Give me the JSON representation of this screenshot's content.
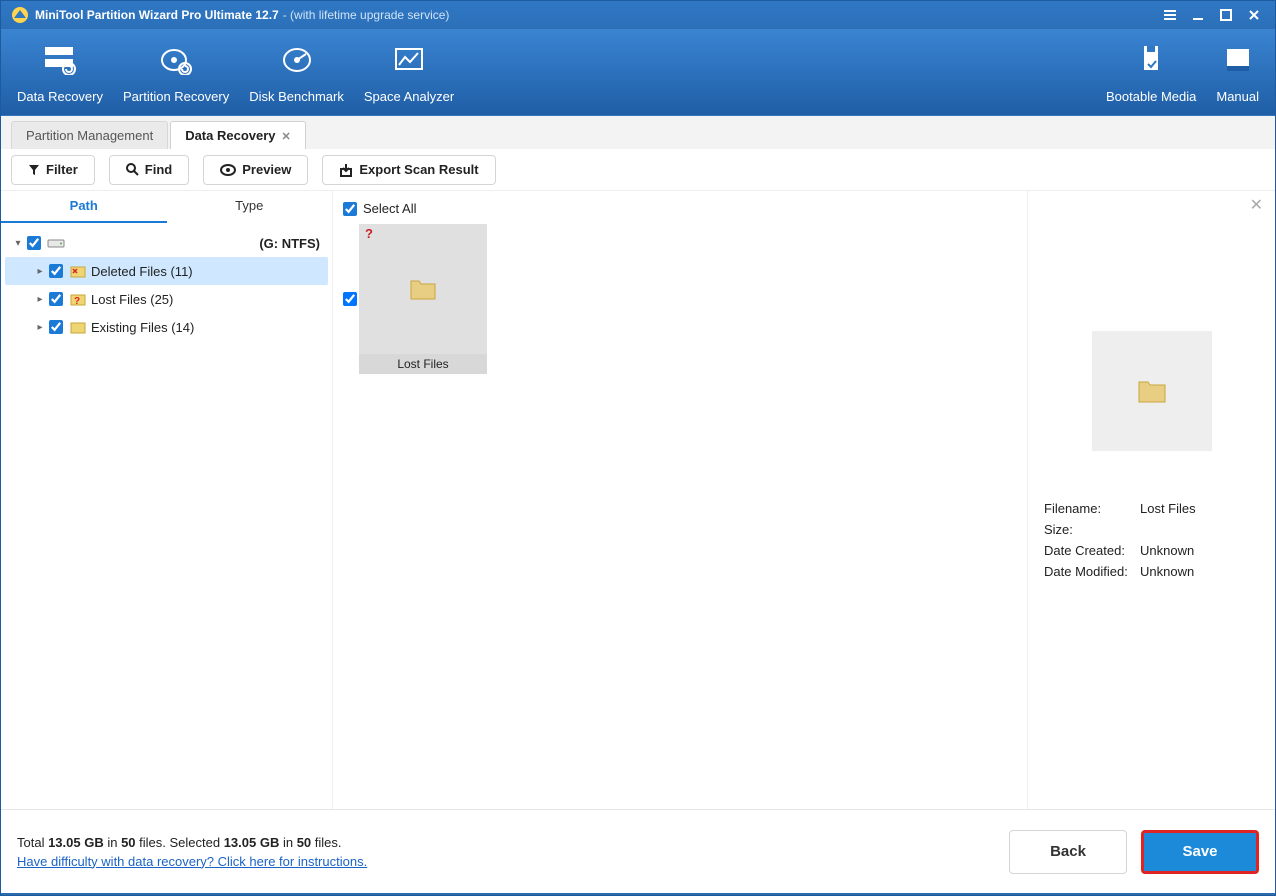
{
  "title": {
    "name": "MiniTool Partition Wizard Pro Ultimate 12.7",
    "sub": "- (with lifetime upgrade service)"
  },
  "ribbon": {
    "data_recovery": "Data Recovery",
    "partition_recovery": "Partition Recovery",
    "disk_benchmark": "Disk Benchmark",
    "space_analyzer": "Space Analyzer",
    "bootable_media": "Bootable Media",
    "manual": "Manual"
  },
  "tabs": {
    "partition_mgmt": "Partition Management",
    "data_recovery": "Data Recovery"
  },
  "toolbar": {
    "filter": "Filter",
    "find": "Find",
    "preview": "Preview",
    "export": "Export Scan Result"
  },
  "subtabs": {
    "path": "Path",
    "type": "Type"
  },
  "tree": {
    "drive_label": "(G: NTFS)",
    "deleted": "Deleted Files (11)",
    "lost": "Lost Files (25)",
    "existing": "Existing Files (14)"
  },
  "center": {
    "select_all": "Select All",
    "thumb_label": "Lost Files"
  },
  "details": {
    "filename_label": "Filename:",
    "filename_value": "Lost Files",
    "size_label": "Size:",
    "size_value": "",
    "created_label": "Date Created:",
    "created_value": "Unknown",
    "modified_label": "Date Modified:",
    "modified_value": "Unknown"
  },
  "footer": {
    "total_prefix": "Total ",
    "total_size": "13.05 GB",
    "in1": " in ",
    "total_files": "50",
    "files1": " files.  Selected ",
    "sel_size": "13.05 GB",
    "in2": " in ",
    "sel_files": "50",
    "files2": " files.",
    "help_link": "Have difficulty with data recovery? Click here for instructions.",
    "back": "Back",
    "save": "Save"
  }
}
